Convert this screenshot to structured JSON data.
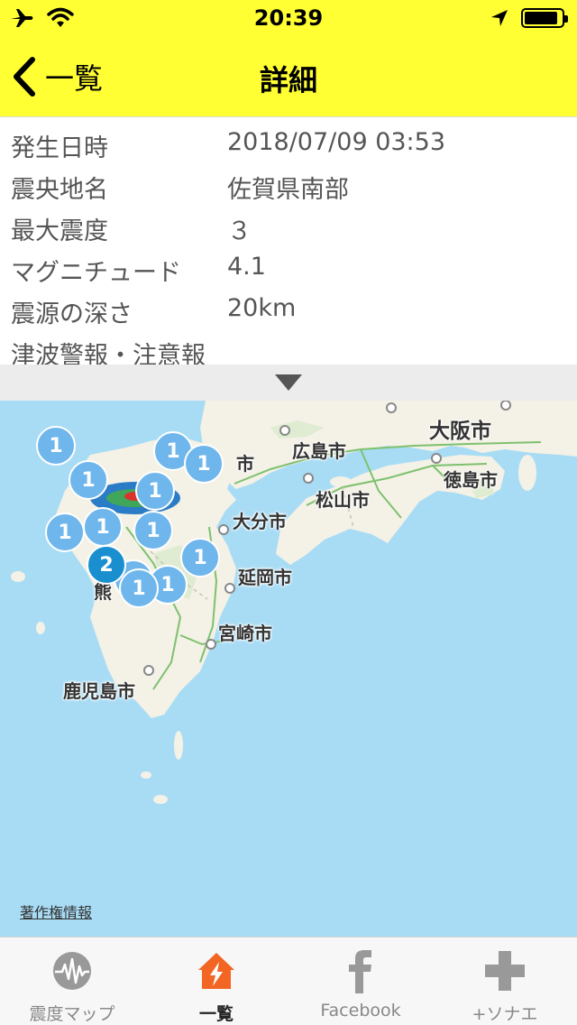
{
  "status_bar": {
    "time": "20:39"
  },
  "nav": {
    "back_label": "一覧",
    "title": "詳細"
  },
  "details": {
    "rows": [
      {
        "label": "発生日時",
        "value": "2018/07/09 03:53"
      },
      {
        "label": "震央地名",
        "value": "佐賀県南部"
      },
      {
        "label": "最大震度",
        "value": "３"
      },
      {
        "label": "マグニチュード",
        "value": "4.1"
      },
      {
        "label": "震源の深さ",
        "value": "20km"
      },
      {
        "label": "津波警報・注意報",
        "value": ""
      }
    ]
  },
  "map": {
    "cities": {
      "osaka": "大阪市",
      "hiroshima": "広島市",
      "matsuyama": "松山市",
      "tokushima": "徳島市",
      "oita": "大分市",
      "nobeoka": "延岡市",
      "miyazaki": "宮崎市",
      "kagoshima": "鹿児島市",
      "partial_shi": "市",
      "partial_kuma": "熊"
    },
    "clusters": [
      "1",
      "1",
      "1",
      "1",
      "1",
      "1",
      "1",
      "1",
      "1",
      "1",
      "1",
      "1",
      "2"
    ],
    "attribution": "著作権情報"
  },
  "tabs": [
    {
      "label": "震度マップ",
      "icon": "seismograph-icon",
      "active": false
    },
    {
      "label": "一覧",
      "icon": "house-lightning-icon",
      "active": true
    },
    {
      "label": "Facebook",
      "icon": "facebook-icon",
      "active": false
    },
    {
      "label": "+ソナエ",
      "icon": "plus-icon",
      "active": false
    }
  ],
  "colors": {
    "header": "#ffff33",
    "active_tab": "#f26522",
    "cluster": "#6fb6ec",
    "sea": "#a8dcf5",
    "land": "#f4f1e6"
  }
}
